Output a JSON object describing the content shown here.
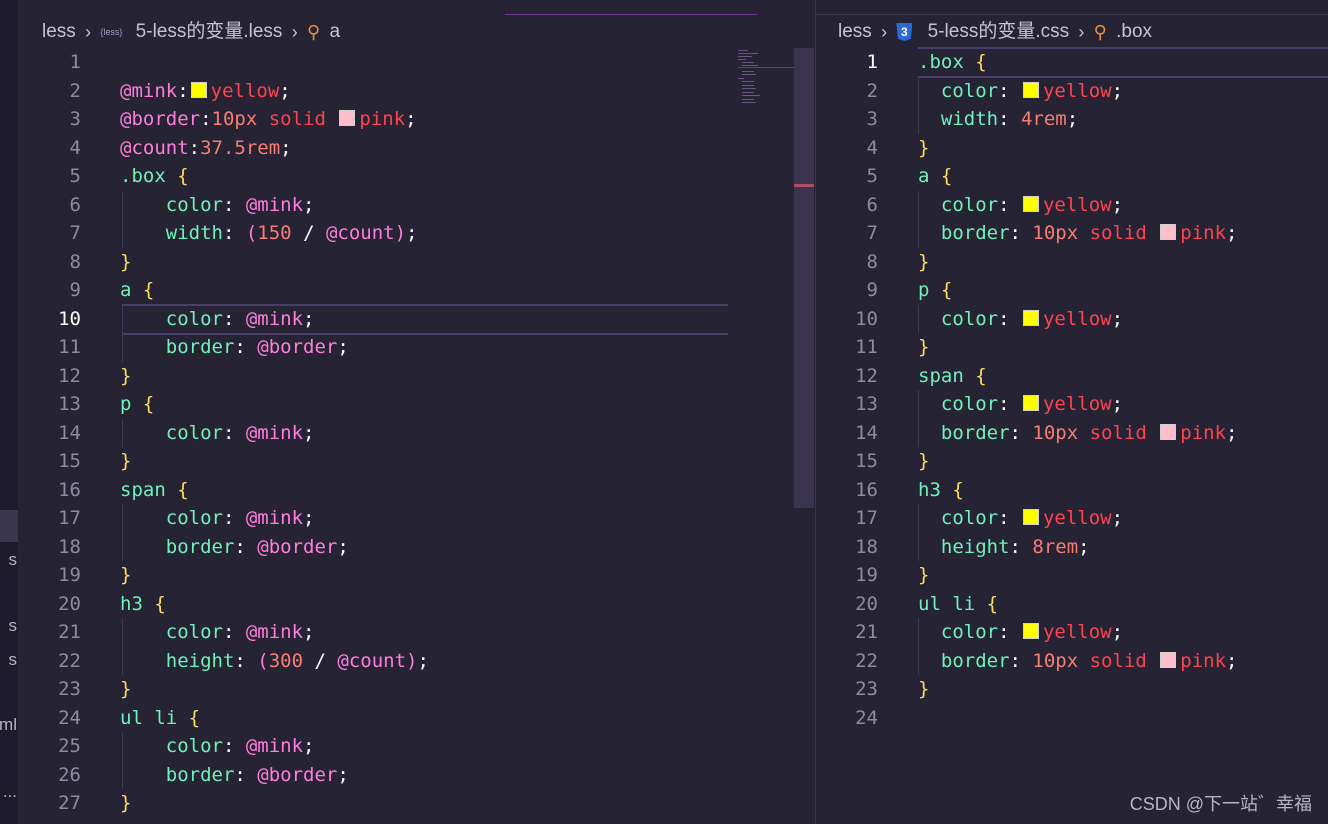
{
  "activity_fragments": [
    "s",
    "s",
    "s",
    "ml",
    "..."
  ],
  "left_editor": {
    "breadcrumb": {
      "folder": "less",
      "file": "5-less的变量.less",
      "file_icon": "{less}",
      "symbol": "a",
      "symbol_icon": "symbol-class-icon"
    },
    "active_line": 10,
    "lines": [
      {
        "n": "1",
        "t": []
      },
      {
        "n": "2",
        "t": [
          [
            "@mink",
            "var"
          ],
          [
            ":",
            "punc"
          ],
          [
            "",
            "swy"
          ],
          [
            "yellow",
            "val"
          ],
          [
            ";",
            "punc"
          ]
        ]
      },
      {
        "n": "3",
        "t": [
          [
            "@border",
            "var"
          ],
          [
            ":",
            "punc"
          ],
          [
            "10px",
            "num"
          ],
          [
            " solid ",
            "val"
          ],
          [
            "",
            "swp"
          ],
          [
            "pink",
            "val"
          ],
          [
            ";",
            "punc"
          ]
        ]
      },
      {
        "n": "4",
        "t": [
          [
            "@count",
            "var"
          ],
          [
            ":",
            "punc"
          ],
          [
            "37.5rem",
            "num"
          ],
          [
            ";",
            "punc"
          ]
        ]
      },
      {
        "n": "5",
        "t": [
          [
            ".box ",
            "sel"
          ],
          [
            "{",
            "brace"
          ]
        ]
      },
      {
        "n": "6",
        "t": [
          [
            "    color",
            "prop"
          ],
          [
            ": ",
            "punc"
          ],
          [
            "@mink",
            "var"
          ],
          [
            ";",
            "punc"
          ]
        ]
      },
      {
        "n": "7",
        "t": [
          [
            "    width",
            "prop"
          ],
          [
            ": ",
            "punc"
          ],
          [
            "(",
            "var"
          ],
          [
            "150",
            "num"
          ],
          [
            " / ",
            "punc"
          ],
          [
            "@count",
            "var"
          ],
          [
            ")",
            "var"
          ],
          [
            ";",
            "punc"
          ]
        ]
      },
      {
        "n": "8",
        "t": [
          [
            "}",
            "brace"
          ]
        ]
      },
      {
        "n": "9",
        "t": [
          [
            "a ",
            "sel"
          ],
          [
            "{",
            "brace"
          ]
        ]
      },
      {
        "n": "10",
        "t": [
          [
            "    color",
            "prop"
          ],
          [
            ": ",
            "punc"
          ],
          [
            "@mink",
            "var"
          ],
          [
            ";",
            "punc"
          ]
        ]
      },
      {
        "n": "11",
        "t": [
          [
            "    border",
            "prop"
          ],
          [
            ": ",
            "punc"
          ],
          [
            "@border",
            "var"
          ],
          [
            ";",
            "punc"
          ]
        ]
      },
      {
        "n": "12",
        "t": [
          [
            "}",
            "brace"
          ]
        ]
      },
      {
        "n": "13",
        "t": [
          [
            "p ",
            "sel"
          ],
          [
            "{",
            "brace"
          ]
        ]
      },
      {
        "n": "14",
        "t": [
          [
            "    color",
            "prop"
          ],
          [
            ": ",
            "punc"
          ],
          [
            "@mink",
            "var"
          ],
          [
            ";",
            "punc"
          ]
        ]
      },
      {
        "n": "15",
        "t": [
          [
            "}",
            "brace"
          ]
        ]
      },
      {
        "n": "16",
        "t": [
          [
            "span ",
            "sel"
          ],
          [
            "{",
            "brace"
          ]
        ]
      },
      {
        "n": "17",
        "t": [
          [
            "    color",
            "prop"
          ],
          [
            ": ",
            "punc"
          ],
          [
            "@mink",
            "var"
          ],
          [
            ";",
            "punc"
          ]
        ]
      },
      {
        "n": "18",
        "t": [
          [
            "    border",
            "prop"
          ],
          [
            ": ",
            "punc"
          ],
          [
            "@border",
            "var"
          ],
          [
            ";",
            "punc"
          ]
        ]
      },
      {
        "n": "19",
        "t": [
          [
            "}",
            "brace"
          ]
        ]
      },
      {
        "n": "20",
        "t": [
          [
            "h3 ",
            "sel"
          ],
          [
            "{",
            "brace"
          ]
        ]
      },
      {
        "n": "21",
        "t": [
          [
            "    color",
            "prop"
          ],
          [
            ": ",
            "punc"
          ],
          [
            "@mink",
            "var"
          ],
          [
            ";",
            "punc"
          ]
        ]
      },
      {
        "n": "22",
        "t": [
          [
            "    height",
            "prop"
          ],
          [
            ": ",
            "punc"
          ],
          [
            "(",
            "var"
          ],
          [
            "300",
            "num"
          ],
          [
            " / ",
            "punc"
          ],
          [
            "@count",
            "var"
          ],
          [
            ")",
            "var"
          ],
          [
            ";",
            "punc"
          ]
        ]
      },
      {
        "n": "23",
        "t": [
          [
            "}",
            "brace"
          ]
        ]
      },
      {
        "n": "24",
        "t": [
          [
            "ul li ",
            "sel"
          ],
          [
            "{",
            "brace"
          ]
        ]
      },
      {
        "n": "25",
        "t": [
          [
            "    color",
            "prop"
          ],
          [
            ": ",
            "punc"
          ],
          [
            "@mink",
            "var"
          ],
          [
            ";",
            "punc"
          ]
        ]
      },
      {
        "n": "26",
        "t": [
          [
            "    border",
            "prop"
          ],
          [
            ": ",
            "punc"
          ],
          [
            "@border",
            "var"
          ],
          [
            ";",
            "punc"
          ]
        ]
      },
      {
        "n": "27",
        "t": [
          [
            "}",
            "brace"
          ]
        ]
      }
    ]
  },
  "right_editor": {
    "breadcrumb": {
      "folder": "less",
      "file": "5-less的变量.css",
      "file_icon": "3",
      "symbol": ".box",
      "symbol_icon": "symbol-class-icon"
    },
    "active_line": 1,
    "lines": [
      {
        "n": "1",
        "t": [
          [
            ".box ",
            "sel"
          ],
          [
            "{",
            "brace"
          ]
        ]
      },
      {
        "n": "2",
        "t": [
          [
            "  color",
            "prop"
          ],
          [
            ": ",
            "punc"
          ],
          [
            "",
            "swy"
          ],
          [
            "yellow",
            "val"
          ],
          [
            ";",
            "punc"
          ]
        ]
      },
      {
        "n": "3",
        "t": [
          [
            "  width",
            "prop"
          ],
          [
            ": ",
            "punc"
          ],
          [
            "4rem",
            "num"
          ],
          [
            ";",
            "punc"
          ]
        ]
      },
      {
        "n": "4",
        "t": [
          [
            "}",
            "brace"
          ]
        ]
      },
      {
        "n": "5",
        "t": [
          [
            "a ",
            "sel"
          ],
          [
            "{",
            "brace"
          ]
        ]
      },
      {
        "n": "6",
        "t": [
          [
            "  color",
            "prop"
          ],
          [
            ": ",
            "punc"
          ],
          [
            "",
            "swy"
          ],
          [
            "yellow",
            "val"
          ],
          [
            ";",
            "punc"
          ]
        ]
      },
      {
        "n": "7",
        "t": [
          [
            "  border",
            "prop"
          ],
          [
            ": ",
            "punc"
          ],
          [
            "10px",
            "num"
          ],
          [
            " solid ",
            "val"
          ],
          [
            "",
            "swp"
          ],
          [
            "pink",
            "val"
          ],
          [
            ";",
            "punc"
          ]
        ]
      },
      {
        "n": "8",
        "t": [
          [
            "}",
            "brace"
          ]
        ]
      },
      {
        "n": "9",
        "t": [
          [
            "p ",
            "sel"
          ],
          [
            "{",
            "brace"
          ]
        ]
      },
      {
        "n": "10",
        "t": [
          [
            "  color",
            "prop"
          ],
          [
            ": ",
            "punc"
          ],
          [
            "",
            "swy"
          ],
          [
            "yellow",
            "val"
          ],
          [
            ";",
            "punc"
          ]
        ]
      },
      {
        "n": "11",
        "t": [
          [
            "}",
            "brace"
          ]
        ]
      },
      {
        "n": "12",
        "t": [
          [
            "span ",
            "sel"
          ],
          [
            "{",
            "brace"
          ]
        ]
      },
      {
        "n": "13",
        "t": [
          [
            "  color",
            "prop"
          ],
          [
            ": ",
            "punc"
          ],
          [
            "",
            "swy"
          ],
          [
            "yellow",
            "val"
          ],
          [
            ";",
            "punc"
          ]
        ]
      },
      {
        "n": "14",
        "t": [
          [
            "  border",
            "prop"
          ],
          [
            ": ",
            "punc"
          ],
          [
            "10px",
            "num"
          ],
          [
            " solid ",
            "val"
          ],
          [
            "",
            "swp"
          ],
          [
            "pink",
            "val"
          ],
          [
            ";",
            "punc"
          ]
        ]
      },
      {
        "n": "15",
        "t": [
          [
            "}",
            "brace"
          ]
        ]
      },
      {
        "n": "16",
        "t": [
          [
            "h3 ",
            "sel"
          ],
          [
            "{",
            "brace"
          ]
        ]
      },
      {
        "n": "17",
        "t": [
          [
            "  color",
            "prop"
          ],
          [
            ": ",
            "punc"
          ],
          [
            "",
            "swy"
          ],
          [
            "yellow",
            "val"
          ],
          [
            ";",
            "punc"
          ]
        ]
      },
      {
        "n": "18",
        "t": [
          [
            "  height",
            "prop"
          ],
          [
            ": ",
            "punc"
          ],
          [
            "8rem",
            "num"
          ],
          [
            ";",
            "punc"
          ]
        ]
      },
      {
        "n": "19",
        "t": [
          [
            "}",
            "brace"
          ]
        ]
      },
      {
        "n": "20",
        "t": [
          [
            "ul li ",
            "sel"
          ],
          [
            "{",
            "brace"
          ]
        ]
      },
      {
        "n": "21",
        "t": [
          [
            "  color",
            "prop"
          ],
          [
            ": ",
            "punc"
          ],
          [
            "",
            "swy"
          ],
          [
            "yellow",
            "val"
          ],
          [
            ";",
            "punc"
          ]
        ]
      },
      {
        "n": "22",
        "t": [
          [
            "  border",
            "prop"
          ],
          [
            ": ",
            "punc"
          ],
          [
            "10px",
            "num"
          ],
          [
            " solid ",
            "val"
          ],
          [
            "",
            "swp"
          ],
          [
            "pink",
            "val"
          ],
          [
            ";",
            "punc"
          ]
        ]
      },
      {
        "n": "23",
        "t": [
          [
            "}",
            "brace"
          ]
        ]
      },
      {
        "n": "24",
        "t": []
      }
    ]
  },
  "watermark": "CSDN @下一站゛幸福",
  "colors": {
    "background": "#262335",
    "selector": "#72f1b8",
    "variable": "#ff7edb",
    "value": "#fe4450",
    "number": "#f97e72",
    "brace": "#fede5d",
    "swatch_yellow": "#ffff00",
    "swatch_pink": "#ffc0cb"
  }
}
